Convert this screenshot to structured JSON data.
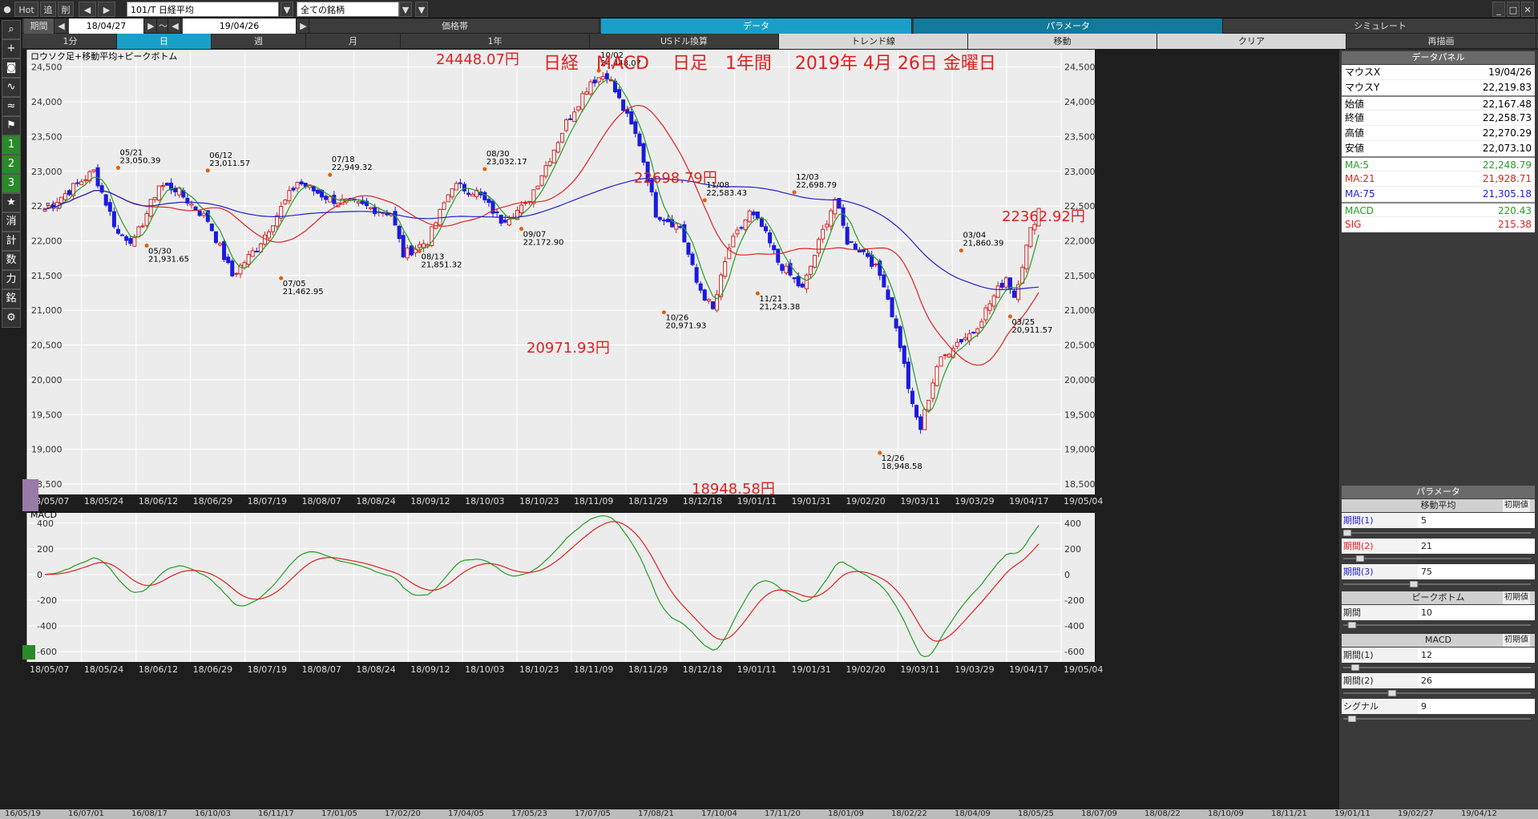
{
  "topbar": {
    "hot": "Hot",
    "tsui": "追",
    "sakujo": "削",
    "code": "101/T 日経平均",
    "filter": "全ての銘柄",
    "kikan": "期間",
    "date_from": "18/04/27",
    "tilde": "～",
    "date_to": "19/04/26"
  },
  "menu1": [
    "価格帯",
    "データ",
    "パラメータ",
    "シミュレート"
  ],
  "menu2": [
    "1分",
    "日",
    "週",
    "月",
    "1年",
    "USドル換算",
    "トレンド線",
    "移動",
    "クリア",
    "再描画"
  ],
  "left_icons": [
    "search-icon",
    "crosshair-icon",
    "camera-icon",
    "chart-icon",
    "indicator-icon",
    "flag-icon",
    "1",
    "2",
    "3",
    "★",
    "消",
    "計",
    "数",
    "力",
    "銘",
    "gear-icon"
  ],
  "chart": {
    "main_label": "ロウソク足+移動平均+ピークボトム",
    "macd_label": "MACD",
    "headline": "日経　MACD　 日足　1年間　 2019年 4月 26日 金曜日",
    "big_labels": [
      "24448.07円",
      "22698.79円",
      "20971.93円",
      "18948.58円",
      "22362.92円"
    ],
    "y_ticks": [
      "24,500",
      "24,000",
      "23,500",
      "23,000",
      "22,500",
      "22,000",
      "21,500",
      "21,000",
      "20,500",
      "20,000",
      "19,500",
      "19,000",
      "18,500"
    ],
    "macd_ticks": [
      "400",
      "200",
      "0",
      "-200",
      "-400",
      "-600"
    ],
    "x_ticks": [
      "18/05/07",
      "18/05/24",
      "18/06/12",
      "18/06/29",
      "18/07/19",
      "18/08/07",
      "18/08/24",
      "18/09/12",
      "18/10/03",
      "18/10/23",
      "18/11/09",
      "18/11/29",
      "18/12/18",
      "19/01/11",
      "19/01/31",
      "19/02/20",
      "19/03/11",
      "19/03/29",
      "19/04/17",
      "19/05/04"
    ],
    "peak_notes": [
      {
        "d": "05/21",
        "v": "23,050.39"
      },
      {
        "d": "06/12",
        "v": "23,011.57"
      },
      {
        "d": "07/18",
        "v": "22,949.32"
      },
      {
        "d": "08/30",
        "v": "23,032.17"
      },
      {
        "d": "10/02",
        "v": "24,448.07"
      },
      {
        "d": "11/08",
        "v": "22,583.43"
      },
      {
        "d": "12/03",
        "v": "22,698.79"
      },
      {
        "d": "03/04",
        "v": "21,860.39"
      },
      {
        "d": "05/30",
        "v": "21,931.65"
      },
      {
        "d": "07/05",
        "v": "21,462.95"
      },
      {
        "d": "08/13",
        "v": "21,851.32"
      },
      {
        "d": "09/07",
        "v": "22,172.90"
      },
      {
        "d": "10/26",
        "v": "20,971.93"
      },
      {
        "d": "11/21",
        "v": "21,243.38"
      },
      {
        "d": "12/26",
        "v": "18,948.58"
      },
      {
        "d": "03/25",
        "v": "20,911.57"
      }
    ]
  },
  "data_panel": {
    "title": "データパネル",
    "rows": [
      {
        "k": "マウスX",
        "v": "19/04/26"
      },
      {
        "k": "マウスY",
        "v": "22,219.83"
      },
      {
        "k": "始値",
        "v": "22,167.48"
      },
      {
        "k": "終値",
        "v": "22,258.73"
      },
      {
        "k": "高値",
        "v": "22,270.29"
      },
      {
        "k": "安値",
        "v": "22,073.10"
      },
      {
        "k": "MA:5",
        "v": "22,248.79"
      },
      {
        "k": "MA:21",
        "v": "21,928.71"
      },
      {
        "k": "MA:75",
        "v": "21,305.18"
      },
      {
        "k": "MACD",
        "v": "220.43"
      },
      {
        "k": "SIG",
        "v": "215.38"
      }
    ],
    "colors": {
      "ma5": "#22a022",
      "ma21": "#e02020",
      "ma75": "#2020d0",
      "macd": "#22a022",
      "sig": "#e02020"
    }
  },
  "params": {
    "title": "パラメータ",
    "ma": "移動平均",
    "init": "初期値",
    "p1": "期間(1)",
    "p1v": "5",
    "p2": "期間(2)",
    "p2v": "21",
    "p3": "期間(3)",
    "p3v": "75",
    "pb": "ピークボトム",
    "pbk": "期間",
    "pbv": "10",
    "macd": "MACD",
    "m1": "期間(1)",
    "m1v": "12",
    "m2": "期間(2)",
    "m2v": "26",
    "sg": "シグナル",
    "sgv": "9"
  },
  "bottom_ticks": [
    "16/05/19",
    "16/07/01",
    "16/08/17",
    "16/10/03",
    "16/11/17",
    "17/01/05",
    "17/02/20",
    "17/04/05",
    "17/05/23",
    "17/07/05",
    "17/08/21",
    "17/10/04",
    "17/11/20",
    "18/01/09",
    "18/02/22",
    "18/04/09",
    "18/05/25",
    "18/07/09",
    "18/08/22",
    "18/10/09",
    "18/11/21",
    "19/01/11",
    "19/02/27",
    "19/04/12"
  ]
}
